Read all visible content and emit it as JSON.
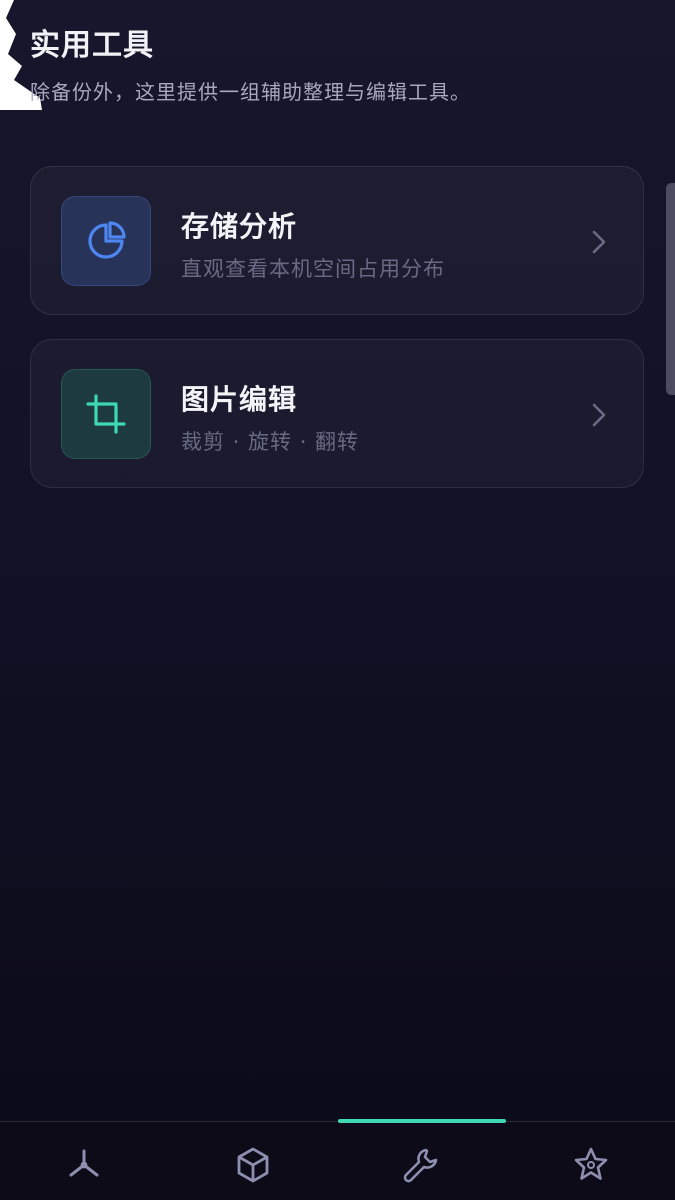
{
  "header": {
    "title": "实用工具",
    "subtitle": "除备份外，这里提供一组辅助整理与编辑工具。"
  },
  "tools": [
    {
      "title": "存储分析",
      "description": "直观查看本机空间占用分布",
      "icon": "pie-chart-icon",
      "accent": "#4d86f0"
    },
    {
      "title": "图片编辑",
      "description": "裁剪 · 旋转 · 翻转",
      "icon": "crop-icon",
      "accent": "#3fd8b5"
    }
  ],
  "bottom_nav": {
    "items": [
      {
        "icon": "share-nodes-icon",
        "active": false
      },
      {
        "icon": "cube-icon",
        "active": false
      },
      {
        "icon": "wrench-icon",
        "active": true
      },
      {
        "icon": "star-badge-icon",
        "active": false
      }
    ],
    "active_color": "#3fd8b5"
  }
}
